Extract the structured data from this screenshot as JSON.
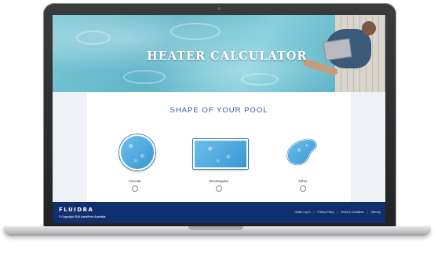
{
  "hero": {
    "title": "HEATER CALCULATOR"
  },
  "section": {
    "title": "SHAPE OF YOUR POOL"
  },
  "pool_options": [
    {
      "label": "Circular",
      "icon": "circular-pool-icon"
    },
    {
      "label": "Rectangular",
      "icon": "rectangular-pool-icon"
    },
    {
      "label": "Other",
      "icon": "kidney-pool-icon"
    }
  ],
  "footer": {
    "brand": "FLUIDRA",
    "copyright": "© Copyright 2019 AstralPool Australia",
    "links": [
      "Dealer Log In",
      "Privacy Policy",
      "Terms & Conditions",
      "Sitemap"
    ],
    "separator": "|"
  },
  "colors": {
    "title_blue": "#2b5ea3",
    "footer_navy": "#0f2f6e",
    "pool_blue": "#3a96d2"
  }
}
